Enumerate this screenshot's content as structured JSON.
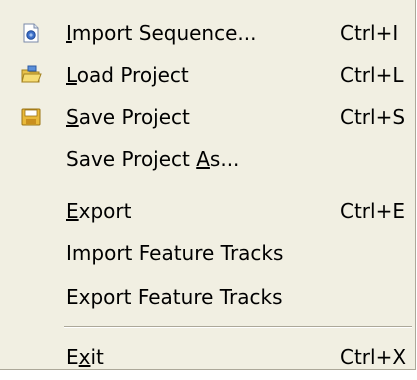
{
  "menu": {
    "items": [
      {
        "label": "Import Sequence...",
        "accel_char": "I",
        "shortcut": "Ctrl+I",
        "icon": "import-sequence-icon"
      },
      {
        "label": "Load Project",
        "accel_char": "L",
        "shortcut": "Ctrl+L",
        "icon": "open-folder-icon"
      },
      {
        "label": "Save Project",
        "accel_char": "S",
        "shortcut": "Ctrl+S",
        "icon": "floppy-disk-icon"
      },
      {
        "label": "Save Project As...",
        "accel_char": "A",
        "shortcut": "",
        "icon": ""
      },
      {
        "label": "Export",
        "accel_char": "E",
        "shortcut": "Ctrl+E",
        "icon": ""
      },
      {
        "label": "Import Feature Tracks",
        "accel_char": "",
        "shortcut": "",
        "icon": ""
      },
      {
        "label": "Export Feature Tracks",
        "accel_char": "",
        "shortcut": "",
        "icon": ""
      },
      {
        "label": "Exit",
        "accel_char": "x",
        "shortcut": "Ctrl+X",
        "icon": ""
      }
    ]
  },
  "colors": {
    "menu_background": "#f1efe2",
    "separator": "#aca899",
    "text": "#000000"
  }
}
